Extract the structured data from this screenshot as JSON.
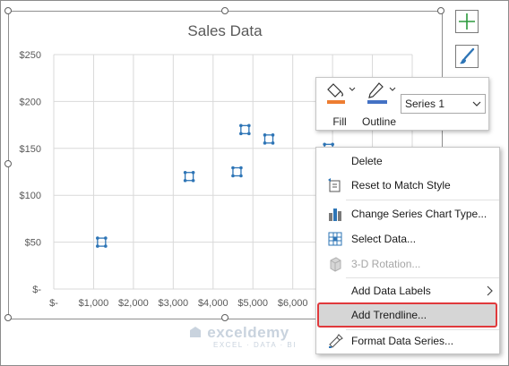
{
  "chart_data": {
    "type": "scatter",
    "title": "Sales Data",
    "xlabel": "",
    "ylabel": "",
    "x_ticks": [
      "$-",
      "$1,000",
      "$2,000",
      "$3,000",
      "$4,000",
      "$5,000",
      "$6,000"
    ],
    "y_ticks": [
      "$-",
      "$50",
      "$100",
      "$150",
      "$200",
      "$250"
    ],
    "xlim": [
      0,
      9000
    ],
    "ylim": [
      0,
      250
    ],
    "grid": true,
    "series": [
      {
        "x": [
          1200,
          3400,
          4600,
          4800,
          5400,
          6900
        ],
        "y": [
          50,
          120,
          125,
          170,
          160,
          150
        ]
      }
    ]
  },
  "colors": {
    "marker": "#2e75b6",
    "fill_accent": "#ed7d31",
    "outline_accent": "#4472c4",
    "plus_icon": "#2b9a3c",
    "highlight_border": "#e0393c"
  },
  "format_panel": {
    "fill_label": "Fill",
    "outline_label": "Outline",
    "series_selected": "Series 1"
  },
  "menu": {
    "delete": "Delete",
    "reset": "Reset to Match Style",
    "change_type": "Change Series Chart Type...",
    "select_data": "Select Data...",
    "rotation": "3-D Rotation...",
    "add_labels": "Add Data Labels",
    "add_trendline": "Add Trendline...",
    "format_series": "Format Data Series..."
  },
  "watermark": {
    "name": "exceldemy",
    "tag": "EXCEL · DATA · BI"
  }
}
